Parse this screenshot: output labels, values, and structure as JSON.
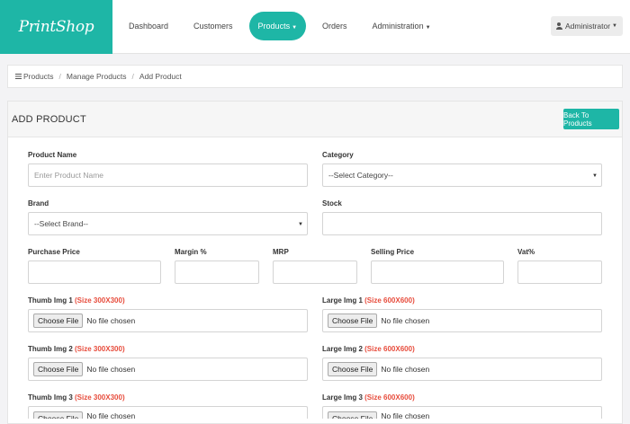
{
  "app": {
    "logo": "PrintShop"
  },
  "nav": {
    "items": [
      {
        "label": "Dashboard"
      },
      {
        "label": "Customers"
      },
      {
        "label": "Products"
      },
      {
        "label": "Orders"
      },
      {
        "label": "Administration"
      }
    ],
    "user": "Administrator",
    "accent": "#1eb6a6"
  },
  "breadcrumb": {
    "items": [
      "Products",
      "Manage Products",
      "Add Product"
    ]
  },
  "panel": {
    "title": "ADD PRODUCT",
    "back_label": "Back To Products"
  },
  "form": {
    "product_name": {
      "label": "Product Name",
      "placeholder": "Enter Product Name"
    },
    "category": {
      "label": "Category",
      "value": "--Select Category--"
    },
    "brand": {
      "label": "Brand",
      "value": "--Select Brand--"
    },
    "stock": {
      "label": "Stock",
      "value": ""
    },
    "purchase_price": {
      "label": "Purchase Price"
    },
    "margin": {
      "label": "Margin %"
    },
    "mrp": {
      "label": "MRP"
    },
    "selling_price": {
      "label": "Selling Price"
    },
    "vat": {
      "label": "Vat%"
    },
    "file_button": "Choose File",
    "file_status": "No file chosen",
    "thumb1": {
      "label": "Thumb Img 1",
      "size": "(Size 300X300)"
    },
    "large1": {
      "label": "Large Img 1",
      "size": "(Size 600X600)"
    },
    "thumb2": {
      "label": "Thumb Img 2",
      "size": "(Size 300X300)"
    },
    "large2": {
      "label": "Large Img 2",
      "size": "(Size 600X600)"
    },
    "thumb3": {
      "label": "Thumb Img 3",
      "size": "(Size 300X300)"
    },
    "large3": {
      "label": "Large Img 3",
      "size": "(Size 600X600)"
    }
  }
}
